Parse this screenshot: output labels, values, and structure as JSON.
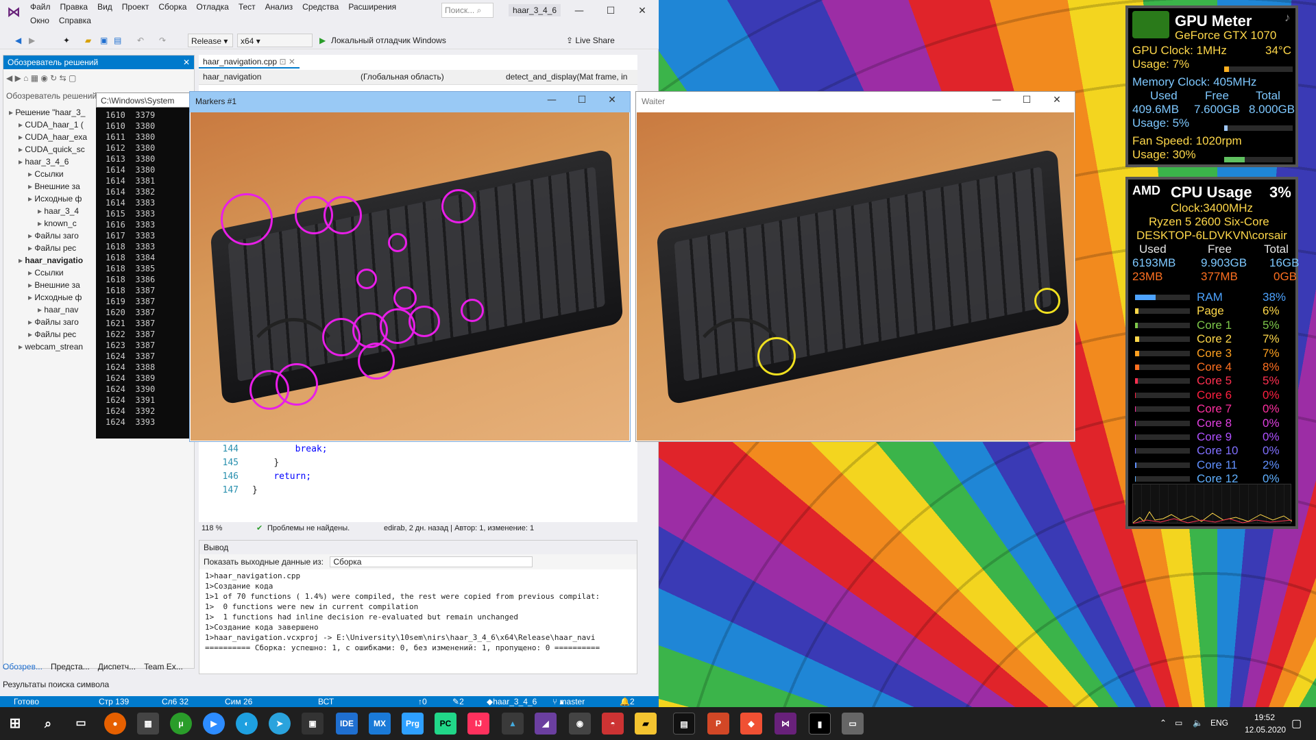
{
  "vs": {
    "menu1": [
      "Файл",
      "Правка",
      "Вид",
      "Проект",
      "Сборка",
      "Отладка",
      "Тест",
      "Анализ",
      "Средства",
      "Расширения"
    ],
    "menu2": [
      "Окно",
      "Справка"
    ],
    "search_placeholder": "Поиск...",
    "project_tab": "haar_3_4_6",
    "toolbar": {
      "config": "Release",
      "platform": "x64",
      "debugger": "Локальный отладчик Windows",
      "live_share": "Live Share"
    },
    "solution_explorer": {
      "title": "Обозреватель решений",
      "search": "Обозреватель решений",
      "items": [
        "Решение \"haar_3_",
        "CUDA_haar_1 (",
        "CUDA_haar_exa",
        "CUDA_quick_sc",
        "haar_3_4_6",
        "Ссылки",
        "Внешние за",
        "Исходные ф",
        "haar_3_4",
        "known_c",
        "Файлы заго",
        "Файлы рес",
        "haar_navigatio",
        "Ссылки",
        "Внешние за",
        "Исходные ф",
        "haar_nav",
        "Файлы заго",
        "Файлы рес",
        "webcam_strean"
      ]
    },
    "bottom_tabs": [
      "Обозрев...",
      "Предста...",
      "Диспетч...",
      "Team Ex..."
    ],
    "find_results": "Результаты поиска символа",
    "cmd": {
      "title": "C:\\Windows\\System",
      "lines": [
        "1610  3379",
        "1610  3380",
        "1611  3380",
        "1612  3380",
        "1613  3380",
        "1614  3380",
        "1614  3381",
        "1614  3382",
        "1614  3383",
        "1615  3383",
        "1616  3383",
        "1617  3383",
        "1618  3383",
        "1618  3384",
        "1618  3385",
        "1618  3386",
        "1618  3387",
        "1619  3387",
        "1620  3387",
        "1621  3387",
        "1622  3387",
        "1623  3387",
        "1624  3387",
        "1624  3388",
        "1624  3389",
        "1624  3390",
        "1624  3391",
        "1624  3392",
        "1624  3393"
      ]
    },
    "editor": {
      "tab": "haar_navigation.cpp",
      "nav_project": "haar_navigation",
      "nav_scope": "(Глобальная область)",
      "nav_func": "detect_and_display(Mat frame, in",
      "code": [
        {
          "ln": "144",
          "text": "break;",
          "kw": true,
          "indent": "        "
        },
        {
          "ln": "145",
          "text": "}",
          "kw": false,
          "indent": "    "
        },
        {
          "ln": "146",
          "text": "return;",
          "kw": true,
          "indent": "    "
        },
        {
          "ln": "147",
          "text": "}",
          "kw": false,
          "indent": ""
        }
      ],
      "zoom": "118 %",
      "problems": "Проблемы не найдены.",
      "blame": "edirab, 2 дн. назад | Автор: 1, изменение: 1"
    },
    "output": {
      "title": "Вывод",
      "show_label": "Показать выходные данные из:",
      "source": "Сборка",
      "lines": [
        "1>haar_navigation.cpp",
        "1>Создание кода",
        "1>1 of 70 functions ( 1.4%) were compiled, the rest were copied from previous compilat:",
        "1>  0 functions were new in current compilation",
        "1>  1 functions had inline decision re-evaluated but remain unchanged",
        "1>Создание кода завершено",
        "1>haar_navigation.vcxproj -> E:\\University\\10sem\\nirs\\haar_3_4_6\\x64\\Release\\haar_navi",
        "========== Сборка: успешно: 1, с ошибками: 0, без изменений: 1, пропущено: 0 =========="
      ]
    },
    "status": {
      "ready": "Готово",
      "line": "Стр 139",
      "col": "Сл6 32",
      "ch": "Сим 26",
      "ins": "ВСТ",
      "up": "0",
      "pencil": "2",
      "repo": "haar_3_4_6",
      "branch": "master",
      "notif": "2"
    }
  },
  "windows": {
    "markers": {
      "title": "Markers #1"
    },
    "waiter": {
      "title": "Waiter"
    }
  },
  "gpu": {
    "title": "GPU Meter",
    "model": "GeForce GTX 1070",
    "clock": "GPU Clock: 1MHz",
    "temp": "34°C",
    "usage": "Usage: 7%",
    "usage_pct": 7,
    "mem_clock": "Memory Clock: 405MHz",
    "mem_headers": [
      "Used",
      "Free",
      "Total"
    ],
    "mem_values": [
      "409.6MB",
      "7.600GB",
      "8.000GB"
    ],
    "mem_usage": "Usage: 5%",
    "mem_usage_pct": 5,
    "fan": "Fan Speed: 1020rpm",
    "fan_usage": "Usage: 30%",
    "fan_pct": 30
  },
  "cpu": {
    "title": "CPU Usage",
    "total": "3%",
    "brand": "AMD",
    "clock": "Clock:3400MHz",
    "model": "Ryzen 5 2600 Six-Core",
    "host": "DESKTOP-6LDVKVN\\corsair",
    "headers": [
      "Used",
      "Free",
      "Total"
    ],
    "row1": [
      "6193MB",
      "9.903GB",
      "16GB"
    ],
    "row2": [
      "23MB",
      "377MB",
      "0GB"
    ],
    "meters": [
      {
        "label": "RAM",
        "value": "38%",
        "pct": 38,
        "color": "#4da3ff"
      },
      {
        "label": "Page",
        "value": "6%",
        "pct": 6,
        "color": "#ffd84a"
      },
      {
        "label": "Core 1",
        "value": "5%",
        "pct": 5,
        "color": "#7ec84a"
      },
      {
        "label": "Core 2",
        "value": "7%",
        "pct": 7,
        "color": "#ffd84a"
      },
      {
        "label": "Core 3",
        "value": "7%",
        "pct": 7,
        "color": "#ffa020"
      },
      {
        "label": "Core 4",
        "value": "8%",
        "pct": 8,
        "color": "#ff7020"
      },
      {
        "label": "Core 5",
        "value": "5%",
        "pct": 5,
        "color": "#ff3050"
      },
      {
        "label": "Core 6",
        "value": "0%",
        "pct": 0,
        "color": "#ff2040"
      },
      {
        "label": "Core 7",
        "value": "0%",
        "pct": 0,
        "color": "#ff30a0"
      },
      {
        "label": "Core 8",
        "value": "0%",
        "pct": 0,
        "color": "#e040e0"
      },
      {
        "label": "Core 9",
        "value": "0%",
        "pct": 0,
        "color": "#b050ff"
      },
      {
        "label": "Core 10",
        "value": "0%",
        "pct": 0,
        "color": "#8070ff"
      },
      {
        "label": "Core 11",
        "value": "2%",
        "pct": 2,
        "color": "#6090ff"
      },
      {
        "label": "Core 12",
        "value": "0%",
        "pct": 0,
        "color": "#60b0ff"
      }
    ]
  },
  "taskbar": {
    "apps": [
      "IDE",
      "MX",
      "Prg",
      "PC",
      "IJ"
    ],
    "lang": "ENG",
    "time": "19:52",
    "date": "12.05.2020"
  }
}
